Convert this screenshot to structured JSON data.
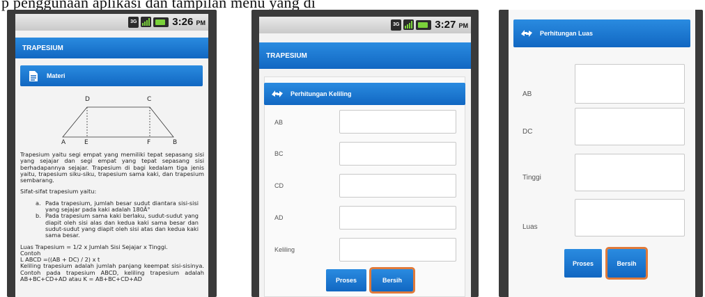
{
  "caption": "p penggunaan aplikasi dan tampilan menu yang di",
  "phone1": {
    "status_network": "3G",
    "status_time": "3:26",
    "status_ampm": "PM",
    "title": "TRAPESIUM",
    "section_title": "Materi",
    "diagram": {
      "labels": [
        "D",
        "C",
        "A",
        "E",
        "F",
        "B"
      ]
    },
    "paragraph1": "Trapesium yaitu segi empat yang memiliki tepat sepasang sisi yang sejajar dan segi empat yang tepat sepasang sisi berhadapannya sejajar. Trapesium di bagi kedalam tiga jenis yaitu, trapesium siku-siku, trapesium sama kaki, dan trapesium sembarang.",
    "properties_heading": "Sifat-sifat trapesium yaitu:",
    "properties": [
      {
        "marker": "a.",
        "text": "Pada trapesium, jumlah besar sudut diantara sisi-sisi yang sejajar pada kaki adalah 180Â°"
      },
      {
        "marker": "b.",
        "text": "Pada trapesium sama kaki berlaku, sudut-sudut yang diapit oleh sisi alas dan kedua kaki sama besar dan sudut-sudut yang diapit oleh sisi atas dan kedua kaki sama besar."
      }
    ],
    "formula_luas": "Luas Trapesium = 1/2 x Jumlah Sisi Sejajar x Tinggi.",
    "contoh_label": "Contoh",
    "contoh_formula": "L ABCD =((AB + DC) / 2) x t",
    "paragraph_keliling": "Keliling trapesium adalah jumlah panjang keempat sisi-sisinya. Contoh pada trapesium ABCD, keliling trapesium adalah AB+BC+CD+AD atau K = AB+BC+CD+AD"
  },
  "phone2": {
    "status_network": "3G",
    "status_time": "3:27",
    "status_ampm": "PM",
    "title": "TRAPESIUM",
    "section_title": "Perhitungan Keliling",
    "fields": [
      {
        "label": "AB",
        "value": ""
      },
      {
        "label": "BC",
        "value": ""
      },
      {
        "label": "CD",
        "value": ""
      },
      {
        "label": "AD",
        "value": ""
      },
      {
        "label": "Keliling",
        "value": ""
      }
    ],
    "proses_label": "Proses",
    "bersih_label": "Bersih"
  },
  "phone3": {
    "section_title": "Perhitungan Luas",
    "fields": [
      {
        "label": "AB",
        "value": ""
      },
      {
        "label": "DC",
        "value": ""
      },
      {
        "label": "Tinggi",
        "value": ""
      },
      {
        "label": "Luas",
        "value": ""
      }
    ],
    "proses_label": "Proses",
    "bersih_label": "Bersih"
  },
  "colors": {
    "header_blue": "#1a78d4",
    "highlight_orange": "#e07a3a"
  },
  "icons": {
    "materi": "document-icon",
    "calc": "calculator-arrows-icon"
  }
}
